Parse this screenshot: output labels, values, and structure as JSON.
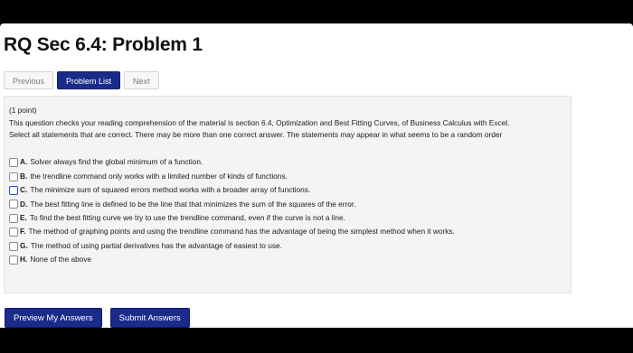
{
  "title": "RQ Sec 6.4: Problem 1",
  "nav": {
    "previous": "Previous",
    "problem_list": "Problem List",
    "next": "Next"
  },
  "problem": {
    "points": "(1 point)",
    "intro": "This question checks your reading comprehension of the material is section 6.4, Optimization and Best Fitting Curves, of Business Calculus with Excel.",
    "instructions": "Select all statements that are correct. There may be more than one correct answer. The statements may appear in what seems to be a random order"
  },
  "choices": [
    {
      "letter": "A.",
      "text": "Solver always find the global minimum of a function.",
      "checked": false
    },
    {
      "letter": "B.",
      "text": "the trendline command only works with a limited number of kinds of functions.",
      "checked": false
    },
    {
      "letter": "C.",
      "text": "The minimize sum of squared errors method works with a broader array of functions.",
      "checked": false
    },
    {
      "letter": "D.",
      "text": "The best fitting line is defined to be the line that that minimizes the sum of the squares of the error.",
      "checked": false
    },
    {
      "letter": "E.",
      "text": "To find the best fitting curve we try to use the trendline command, even if the curve is not a line.",
      "checked": false
    },
    {
      "letter": "F.",
      "text": "The method of graphing points and using the trendline command has the advantage of being the simplest method when it works.",
      "checked": false
    },
    {
      "letter": "G.",
      "text": "The method of using partial derivatives has the advantage of easiest to use.",
      "checked": false
    },
    {
      "letter": "H.",
      "text": "None of the above",
      "checked": false
    }
  ],
  "actions": {
    "preview": "Preview My Answers",
    "submit": "Submit Answers"
  },
  "colors": {
    "primary_button": "#1a2b8a",
    "panel_background": "#f4f4f4"
  }
}
